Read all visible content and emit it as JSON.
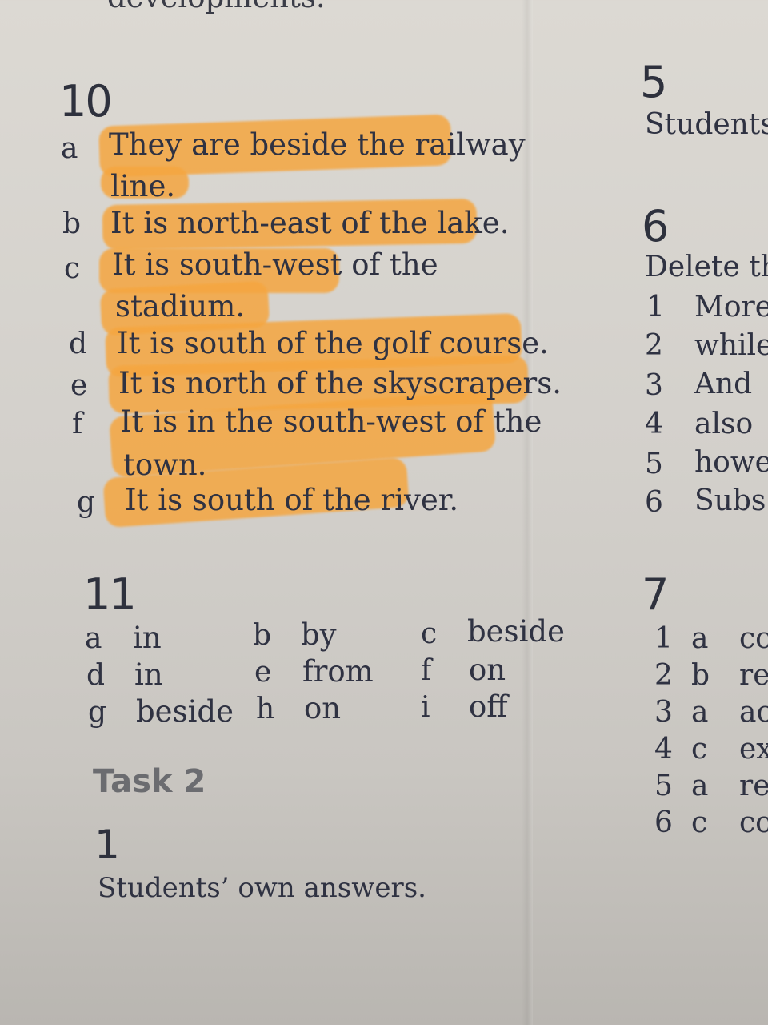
{
  "top_fragment": "developments.",
  "section10": {
    "heading": "10",
    "items": [
      {
        "letter": "a",
        "lines": [
          "They are beside the railway",
          "line."
        ]
      },
      {
        "letter": "b",
        "lines": [
          "It is north-east of the lake."
        ]
      },
      {
        "letter": "c",
        "lines": [
          "It is south-west of the",
          "stadium."
        ]
      },
      {
        "letter": "d",
        "lines": [
          "It is south of the golf course."
        ]
      },
      {
        "letter": "e",
        "lines": [
          "It is north of the skyscrapers."
        ]
      },
      {
        "letter": "f",
        "lines": [
          "It is in the south-west of the",
          "town."
        ]
      },
      {
        "letter": "g",
        "lines": [
          "It is south of the river."
        ]
      }
    ]
  },
  "section11": {
    "heading": "11",
    "grid": [
      [
        {
          "letter": "a",
          "word": "in"
        },
        {
          "letter": "b",
          "word": "by"
        },
        {
          "letter": "c",
          "word": "beside"
        }
      ],
      [
        {
          "letter": "d",
          "word": "in"
        },
        {
          "letter": "e",
          "word": "from"
        },
        {
          "letter": "f",
          "word": "on"
        }
      ],
      [
        {
          "letter": "g",
          "word": "beside"
        },
        {
          "letter": "h",
          "word": "on"
        },
        {
          "letter": "i",
          "word": "off"
        }
      ]
    ]
  },
  "task2": {
    "heading": "Task 2",
    "sub_heading": "1",
    "answer": "Students’ own answers."
  },
  "right_column": {
    "section5": {
      "heading": "5",
      "text": "Students"
    },
    "section6": {
      "heading": "6",
      "intro": "Delete th",
      "items": [
        {
          "num": "1",
          "word": "More"
        },
        {
          "num": "2",
          "word": "while"
        },
        {
          "num": "3",
          "word": "And"
        },
        {
          "num": "4",
          "word": "also"
        },
        {
          "num": "5",
          "word": "howe"
        },
        {
          "num": "6",
          "word": "Subs"
        }
      ]
    },
    "section7": {
      "heading": "7",
      "items": [
        {
          "num": "1",
          "letter": "a",
          "word": "cc"
        },
        {
          "num": "2",
          "letter": "b",
          "word": "re"
        },
        {
          "num": "3",
          "letter": "a",
          "word": "ac"
        },
        {
          "num": "4",
          "letter": "c",
          "word": "ex"
        },
        {
          "num": "5",
          "letter": "a",
          "word": "re"
        },
        {
          "num": "6",
          "letter": "c",
          "word": "co"
        }
      ]
    }
  },
  "colors": {
    "highlight": "#f5a640",
    "paper": "#d6d3ce",
    "ink": "#2f3242"
  }
}
